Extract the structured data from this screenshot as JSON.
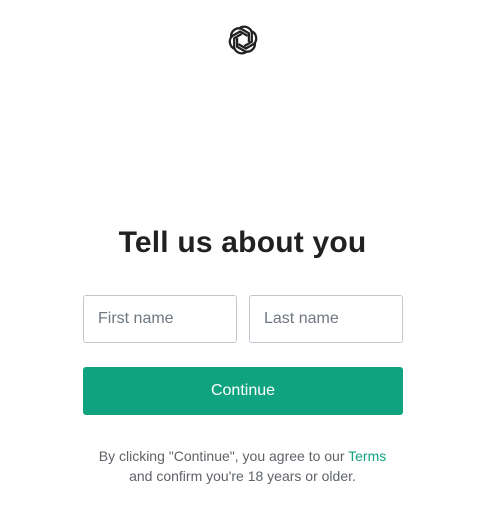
{
  "logo": {
    "icon": "openai-logo-icon",
    "color": "#202123"
  },
  "page": {
    "title": "Tell us about you"
  },
  "form": {
    "first_name": {
      "value": "",
      "placeholder": "First name"
    },
    "last_name": {
      "value": "",
      "placeholder": "Last name"
    },
    "continue_label": "Continue"
  },
  "legal": {
    "line1_prefix": "By clicking \"Continue\", you agree to our ",
    "terms_link": "Terms",
    "line2": "and confirm you're 18 years or older."
  },
  "colors": {
    "accent": "#10a37f",
    "text": "#202123",
    "muted": "#5f6368",
    "border": "#c2c8d0"
  }
}
